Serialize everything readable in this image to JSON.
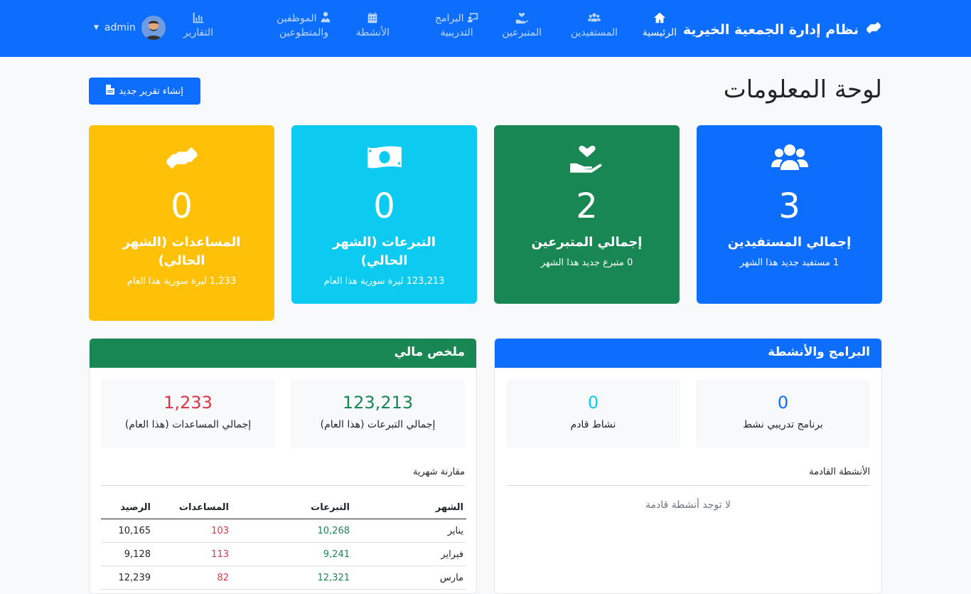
{
  "navbar": {
    "brand": "نظام إدارة الجمعية الخيرية",
    "items": [
      {
        "label": "الرئيسية",
        "icon": "home-icon"
      },
      {
        "label": "المستفيدين",
        "icon": "users-icon"
      },
      {
        "label": "المتبرعين",
        "icon": "hand-holding-heart-icon"
      },
      {
        "label1": "البرامج",
        "label2": "التدريبية",
        "icon": "chalkboard-teacher-icon"
      },
      {
        "label": "الأنشطة",
        "icon": "calendar-icon"
      },
      {
        "label1": "الموظفين",
        "label2": "والمتطوعين",
        "icon": "user-tie-icon"
      },
      {
        "label": "التقارير",
        "icon": "chart-bar-icon"
      }
    ],
    "user": "admin"
  },
  "header": {
    "title": "لوحة المعلومات",
    "new_report": "إنشاء تقرير جديد"
  },
  "stats": [
    {
      "value": "3",
      "label": "إجمالي المستفيدين",
      "sub": "1 مستفيد جديد هذا الشهر",
      "color": "#0d6efd"
    },
    {
      "value": "2",
      "label": "إجمالي المتبرعين",
      "sub": "0 متبرع جديد هذا الشهر",
      "color": "#198754"
    },
    {
      "value": "0",
      "label": "التبرعات (الشهر الحالي)",
      "sub": "123,213 ليرة سورية هذا العام",
      "color": "#0dcaf0"
    },
    {
      "value": "0",
      "label": "المساعدات (الشهر الحالي)",
      "sub": "1,233 ليرة سورية هذا العام",
      "color": "#ffc107"
    }
  ],
  "programs": {
    "title": "البرامج والأنشطة",
    "active_programs": {
      "value": "0",
      "label": "برنامج تدريبي نشط"
    },
    "upcoming_activities": {
      "value": "0",
      "label": "نشاط قادم"
    },
    "section": "الأنشطة القادمة",
    "empty": "لا توجد أنشطة قادمة"
  },
  "finance": {
    "title": "ملخص مالي",
    "donations": {
      "value": "123,213",
      "label": "إجمالي التبرعات (هذا العام)"
    },
    "aid": {
      "value": "1,233",
      "label": "إجمالي المساعدات (هذا العام)"
    },
    "section": "مقارنة شهرية",
    "columns": [
      "الشهر",
      "التبرعات",
      "المساعدات",
      "الرصيد"
    ],
    "rows": [
      {
        "month": "يناير",
        "donations": "10,268",
        "aid": "103",
        "balance": "10,165"
      },
      {
        "month": "فبراير",
        "donations": "9,241",
        "aid": "113",
        "balance": "9,128"
      },
      {
        "month": "مارس",
        "donations": "12,321",
        "aid": "82",
        "balance": "12,239"
      }
    ]
  }
}
